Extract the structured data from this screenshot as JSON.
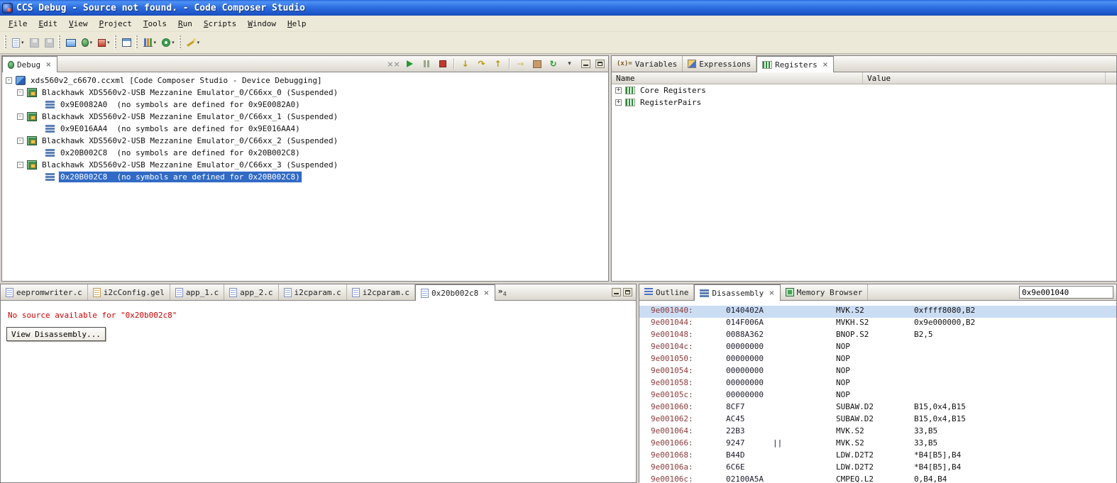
{
  "window": {
    "title": "CCS Debug - Source not found. - Code Composer Studio"
  },
  "menu": {
    "items": [
      "File",
      "Edit",
      "View",
      "Project",
      "Tools",
      "Run",
      "Scripts",
      "Window",
      "Help"
    ]
  },
  "icons": {
    "variables_glyph": "(x)="
  },
  "debug_panel": {
    "tab_label": "Debug",
    "tree": [
      {
        "expander": "-",
        "text": "xds560v2_c6670.ccxml [Code Composer Studio - Device Debugging]"
      },
      {
        "expander": "-",
        "text": "Blackhawk XDS560v2-USB Mezzanine Emulator_0/C66xx_0 (Suspended)"
      },
      {
        "expander": "",
        "text": "0x9E0082A0  (no symbols are defined for 0x9E0082A0)"
      },
      {
        "expander": "-",
        "text": "Blackhawk XDS560v2-USB Mezzanine Emulator_0/C66xx_1 (Suspended)"
      },
      {
        "expander": "",
        "text": "0x9E016AA4  (no symbols are defined for 0x9E016AA4)"
      },
      {
        "expander": "-",
        "text": "Blackhawk XDS560v2-USB Mezzanine Emulator_0/C66xx_2 (Suspended)"
      },
      {
        "expander": "",
        "text": "0x20B002C8  (no symbols are defined for 0x20B002C8)"
      },
      {
        "expander": "-",
        "text": "Blackhawk XDS560v2-USB Mezzanine Emulator_0/C66xx_3 (Suspended)"
      },
      {
        "expander": "",
        "text": "0x20B002C8  (no symbols are defined for 0x20B002C8)"
      }
    ]
  },
  "registers_panel": {
    "tabs": {
      "variables": "Variables",
      "expressions": "Expressions",
      "registers": "Registers"
    },
    "columns": {
      "name": "Name",
      "value": "Value"
    },
    "rows": [
      {
        "expander": "+",
        "name": "Core Registers",
        "value": ""
      },
      {
        "expander": "+",
        "name": "RegisterPairs",
        "value": ""
      }
    ]
  },
  "editor_panel": {
    "tabs": [
      "eepromwriter.c",
      "i2cConfig.gel",
      "app_1.c",
      "app_2.c",
      "i2cparam.c",
      "i2cparam.c",
      "0x20b002c8"
    ],
    "overflow_count": "4",
    "message": "No source available for \"0x20b002c8\"",
    "view_disassembly_label": "View Disassembly..."
  },
  "disassembly_panel": {
    "tabs": {
      "outline": "Outline",
      "disassembly": "Disassembly",
      "memory": "Memory Browser"
    },
    "address_value": "0x9e001040",
    "rows": [
      {
        "addr": "9e001040:",
        "opcode": "0140402A",
        "par": "",
        "mn": "MVK.S2",
        "ops": "0xffff8080,B2"
      },
      {
        "addr": "9e001044:",
        "opcode": "014F006A",
        "par": "",
        "mn": "MVKH.S2",
        "ops": "0x9e000000,B2"
      },
      {
        "addr": "9e001048:",
        "opcode": "0088A362",
        "par": "",
        "mn": "BNOP.S2",
        "ops": "B2,5"
      },
      {
        "addr": "9e00104c:",
        "opcode": "00000000",
        "par": "",
        "mn": "NOP",
        "ops": ""
      },
      {
        "addr": "9e001050:",
        "opcode": "00000000",
        "par": "",
        "mn": "NOP",
        "ops": ""
      },
      {
        "addr": "9e001054:",
        "opcode": "00000000",
        "par": "",
        "mn": "NOP",
        "ops": ""
      },
      {
        "addr": "9e001058:",
        "opcode": "00000000",
        "par": "",
        "mn": "NOP",
        "ops": ""
      },
      {
        "addr": "9e00105c:",
        "opcode": "00000000",
        "par": "",
        "mn": "NOP",
        "ops": ""
      },
      {
        "addr": "9e001060:",
        "opcode": "8CF7",
        "par": "",
        "mn": "SUBAW.D2",
        "ops": "B15,0x4,B15"
      },
      {
        "addr": "9e001062:",
        "opcode": "AC45",
        "par": "",
        "mn": "SUBAW.D2",
        "ops": "B15,0x4,B15"
      },
      {
        "addr": "9e001064:",
        "opcode": "22B3",
        "par": "",
        "mn": "MVK.S2",
        "ops": "33,B5"
      },
      {
        "addr": "9e001066:",
        "opcode": "9247",
        "par": "||",
        "mn": "MVK.S2",
        "ops": "33,B5"
      },
      {
        "addr": "9e001068:",
        "opcode": "B44D",
        "par": "",
        "mn": "LDW.D2T2",
        "ops": "*B4[B5],B4"
      },
      {
        "addr": "9e00106a:",
        "opcode": "6C6E",
        "par": "",
        "mn": "LDW.D2T2",
        "ops": "*B4[B5],B4"
      },
      {
        "addr": "9e00106c:",
        "opcode": "02100A5A",
        "par": "",
        "mn": "CMPEQ.L2",
        "ops": "0,B4,B4"
      }
    ]
  }
}
